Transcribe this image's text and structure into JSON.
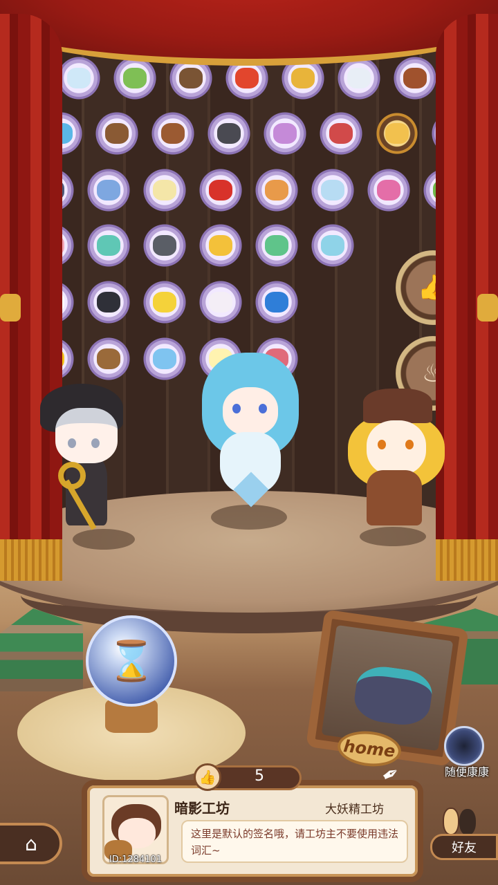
{
  "stage": {
    "items": [
      {
        "name": "ice-item",
        "color": "#cfe8f8"
      },
      {
        "name": "green-stalk-item",
        "color": "#7fbf55"
      },
      {
        "name": "dirt-pile-item",
        "color": "#7a5434"
      },
      {
        "name": "tomato-item",
        "color": "#e2462d"
      },
      {
        "name": "wheat-item",
        "color": "#e8b43a"
      },
      {
        "name": "white-crystal-item",
        "color": "#e8eef6"
      },
      {
        "name": "ore-item",
        "color": "#a0522d"
      },
      {
        "name": "teal-gem-item",
        "color": "#3bb5b0"
      },
      {
        "name": "jellyfish-item",
        "color": "#5ab7e6"
      },
      {
        "name": "mud-item",
        "color": "#8a5a34"
      },
      {
        "name": "brick-item",
        "color": "#9b5a32"
      },
      {
        "name": "coal-shard-item",
        "color": "#4a4a52"
      },
      {
        "name": "purple-coral-item",
        "color": "#c58ad8"
      },
      {
        "name": "mushroom-cluster-item",
        "color": "#d14a4a"
      },
      {
        "name": "golden-flower-item",
        "color": "#f2c14e",
        "gold": true
      },
      {
        "name": "eggplant-item",
        "color": "#6a3fa0"
      },
      {
        "name": "moon-item",
        "color": "#4e5a7a"
      },
      {
        "name": "blue-flower-item",
        "color": "#7ea7e0"
      },
      {
        "name": "lily-item",
        "color": "#f4e6a8"
      },
      {
        "name": "chili-item",
        "color": "#d8322a"
      },
      {
        "name": "shell-item",
        "color": "#e89a4a"
      },
      {
        "name": "ice-shard-item",
        "color": "#b7dcf3"
      },
      {
        "name": "pink-coral-item",
        "color": "#e46ea8"
      },
      {
        "name": "leafy-radish-item",
        "color": "#6fb84a"
      },
      {
        "name": "larva-item",
        "color": "#f3a6b6"
      },
      {
        "name": "rainbow-feather-item",
        "color": "#5fc7b5"
      },
      {
        "name": "rock-item",
        "color": "#5a5e66"
      },
      {
        "name": "yellow-chick-item",
        "color": "#f3c13a"
      },
      {
        "name": "leaf-item",
        "color": "#5fc48a"
      },
      {
        "name": "blue-mushroom-item",
        "color": "#8fd3e8"
      },
      {
        "name": "cloud-item",
        "color": "#ffffff"
      },
      {
        "name": "black-stone-item",
        "color": "#2f3038"
      },
      {
        "name": "star-item",
        "color": "#f4d23a"
      },
      {
        "name": "pearl-item",
        "color": "#f4eef6"
      },
      {
        "name": "blue-slime-item",
        "color": "#2f7ed8"
      },
      {
        "name": "yellow-fruit-item",
        "color": "#f5c21a"
      },
      {
        "name": "wood-item",
        "color": "#9a6a3a"
      },
      {
        "name": "water-orb-item",
        "color": "#7fc4f0"
      },
      {
        "name": "glow-orb-item",
        "color": "#fff3b0"
      },
      {
        "name": "worm-item",
        "color": "#e06a7a"
      }
    ],
    "plaques": [
      {
        "name": "like-plaque",
        "glyph": "👍"
      },
      {
        "name": "cauldron-plaque",
        "glyph": "♨"
      }
    ],
    "orb_glyph": "⌛"
  },
  "home_frame": {
    "tag": "home"
  },
  "random_visit": {
    "label": "随便康康"
  },
  "profile": {
    "likes_icon": "👍",
    "likes": "5",
    "workshop_name": "暗影工坊",
    "workshop_type": "大妖精工坊",
    "signature": "这里是默认的签名哦，请工坊主不要使用违法词汇~",
    "user_id": "ID:1284101"
  },
  "nav": {
    "home_icon": "⌂",
    "friends_label": "好友"
  },
  "colors": {
    "accent": "#c48a52",
    "panel_bg": "#f3e7d4",
    "curtain": "#b52a1e"
  }
}
